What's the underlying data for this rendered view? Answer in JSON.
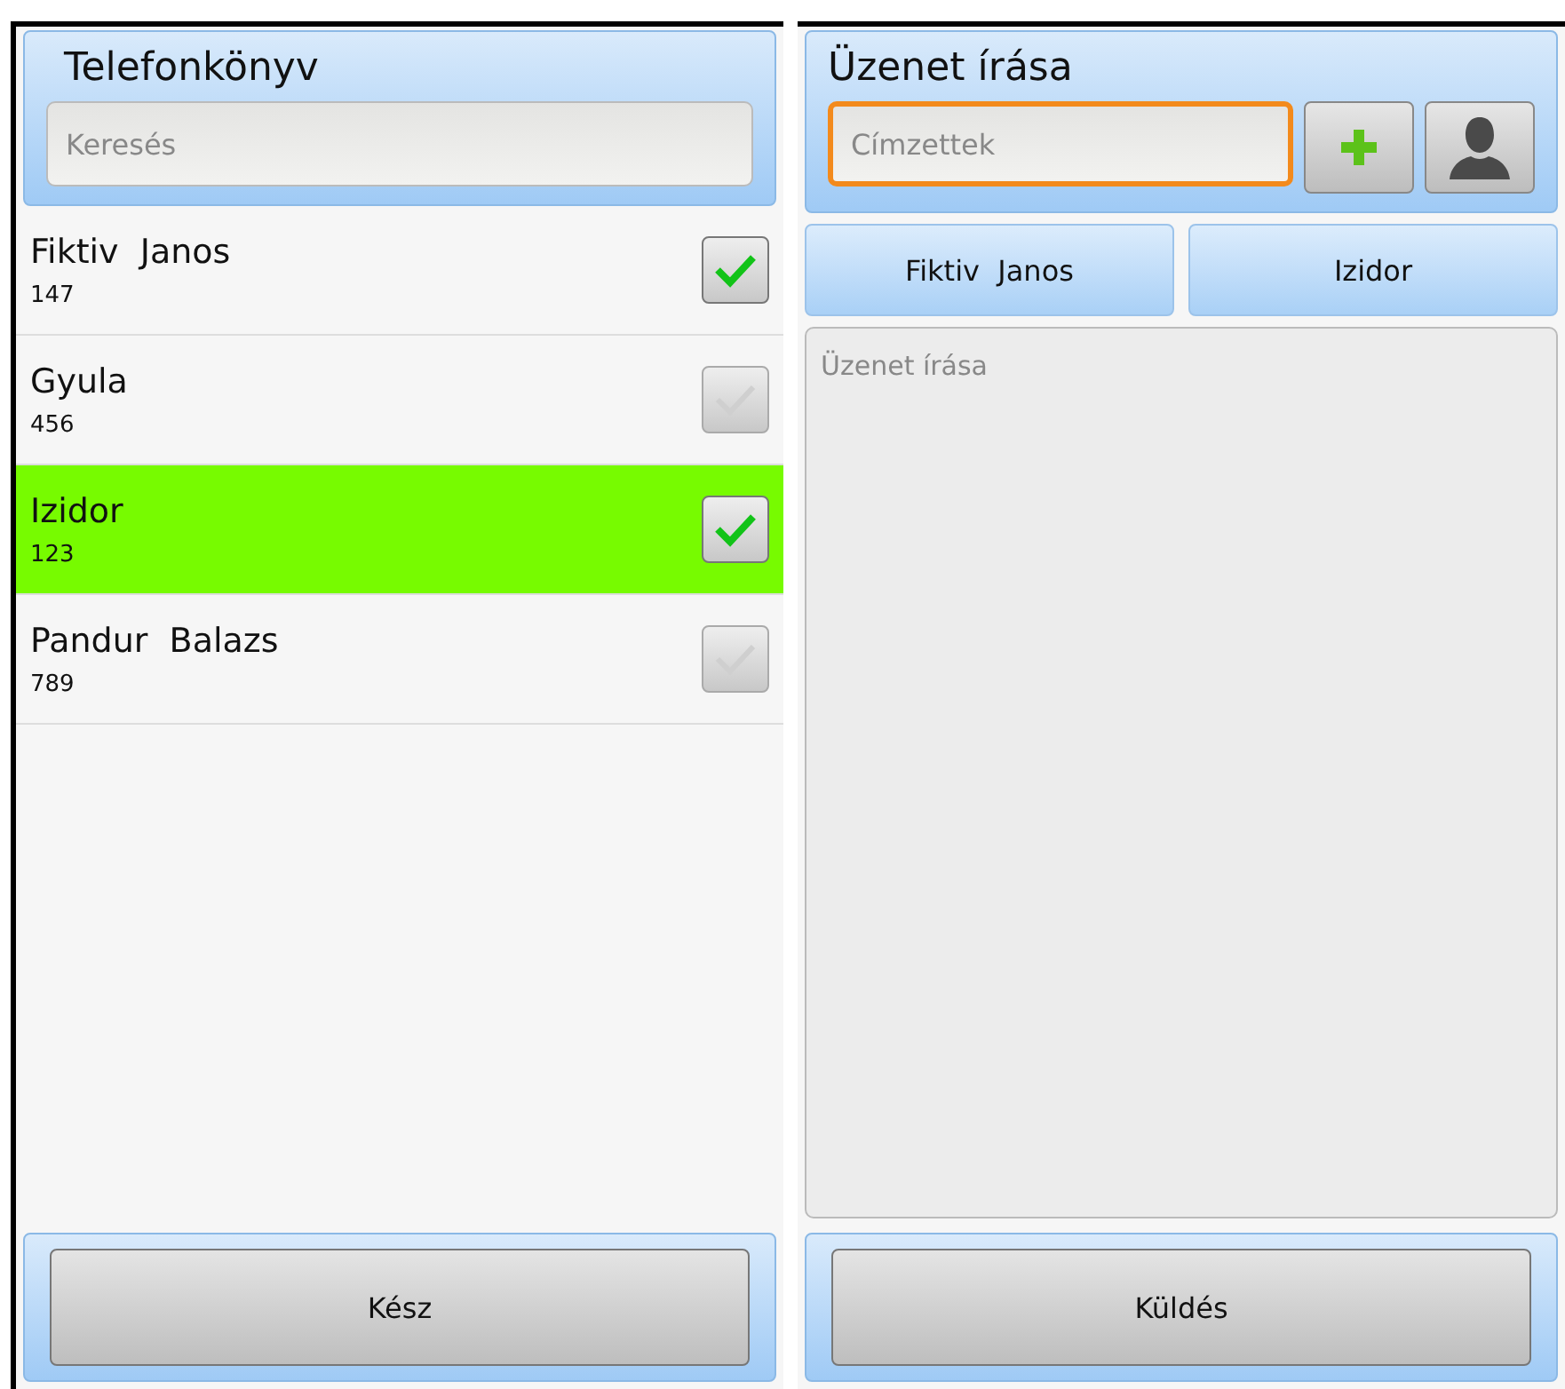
{
  "phonebook": {
    "title": "Telefonkönyv",
    "search": {
      "placeholder": "Keresés"
    },
    "contacts": [
      {
        "name": "Fiktiv  Janos",
        "number": "147",
        "checked": true,
        "selected": false
      },
      {
        "name": "Gyula",
        "number": "456",
        "checked": false,
        "selected": false
      },
      {
        "name": "Izidor",
        "number": "123",
        "checked": true,
        "selected": true
      },
      {
        "name": "Pandur  Balazs",
        "number": "789",
        "checked": false,
        "selected": false
      }
    ],
    "done_button": "Kész"
  },
  "compose": {
    "title": "Üzenet írása",
    "recipients_field": {
      "placeholder": "Címzettek"
    },
    "recipients": [
      "Fiktiv  Janos",
      "Izidor"
    ],
    "message": {
      "placeholder": "Üzenet írása"
    },
    "send_button": "Küldés"
  }
}
